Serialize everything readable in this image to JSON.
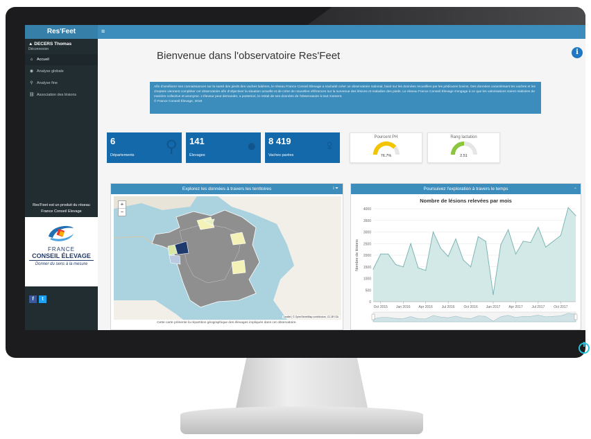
{
  "app": {
    "brand": "Res'Feet",
    "title": "Bienvenue dans l'observatoire Res'Feet",
    "info_icon": "info-icon",
    "intro": "Afin d'améliorer ses connaissances sur la santé des pieds des vaches laitières, le réseau France Conseil Élevage a souhaité créer un observatoire national, basé sur les données recueillies par les pédicures bovins. Des données caractérisant les vaches et les chepteis viennent compléter cet observatoire afin d'objectiver la situation actuelle et de créer de nouvelles références sur la survenue des lésions et maladies des pieds. Le réseau France Conseil Élevage s'engage à ce que les valorisations soient réalisées de manière collective et anonyme. L'éleveur peut demander, a posteriori, le retrait de ses données de l'observatoire à tout moment.\n© France Conseil Élevage, 2018"
  },
  "sidebar": {
    "user_name": "DECERS Thomas",
    "user_role": "Déconnexion",
    "items": [
      {
        "label": "Accueil",
        "icon": "home-icon",
        "glyph": "⌂"
      },
      {
        "label": "Analyse globale",
        "icon": "globe-icon",
        "glyph": "◉"
      },
      {
        "label": "Analyse fine",
        "icon": "search-icon",
        "glyph": "⚲"
      },
      {
        "label": "Association des lésions",
        "icon": "link-icon",
        "glyph": "⛓"
      }
    ],
    "product_text": "Res'Feet est un produit du réseau",
    "product_text2": "France Conseil Elevage",
    "logo": {
      "line1": "FRANCE",
      "line2": "CONSEIL ÉLEVAGE",
      "tagline": "Donner du sens à la mesure"
    },
    "social": {
      "facebook": "f",
      "twitter": "t"
    }
  },
  "kpis": [
    {
      "value": "6",
      "label": "Départements",
      "icon": "map-marker-icon",
      "glyph": "⚲"
    },
    {
      "value": "141",
      "label": "Élevages",
      "icon": "user-icon",
      "glyph": "●"
    },
    {
      "value": "8 419",
      "label": "Vaches parées",
      "icon": "female-icon",
      "glyph": "♀"
    }
  ],
  "gauges": [
    {
      "label": "Pourcent PH",
      "value": "76.7%",
      "fraction": 0.77,
      "color": "#f2c500"
    },
    {
      "label": "Rang lactation",
      "value": "2.51",
      "fraction": 0.5,
      "color": "#8cc63f"
    }
  ],
  "map_panel": {
    "title": "Explorez les données à travers les territoires",
    "tools": "i ⏷",
    "zoom_in": "+",
    "zoom_out": "−",
    "attribution": "Leaflet | © OpenStreetMap contributors, CC-BY-SA",
    "caption": "Cette carte présente la répartition géographique des élevages impliqués dans cet observatoire."
  },
  "chart_panel": {
    "title": "Poursuivez l'exploration à travers le temps",
    "tools": "−"
  },
  "chart_data": {
    "type": "area",
    "title": "Nombre de lésions relevées par mois",
    "xlabel": "",
    "ylabel": "Nombre de lésions",
    "ylim": [
      0,
      4000
    ],
    "yticks": [
      0,
      500,
      1000,
      1500,
      2000,
      2500,
      3000,
      3500,
      4000
    ],
    "xticks": [
      "Oct 2015",
      "Jan 2016",
      "Apr 2016",
      "Jul 2016",
      "Oct 2016",
      "Jan 2017",
      "Apr 2017",
      "Jul 2017",
      "Oct 2017"
    ],
    "x": [
      "Sep 2015",
      "Oct 2015",
      "Nov 2015",
      "Dec 2015",
      "Jan 2016",
      "Feb 2016",
      "Mar 2016",
      "Apr 2016",
      "May 2016",
      "Jun 2016",
      "Jul 2016",
      "Aug 2016",
      "Sep 2016",
      "Oct 2016",
      "Nov 2016",
      "Dec 2016",
      "Jan 2017",
      "Feb 2017",
      "Mar 2017",
      "Apr 2017",
      "May 2017",
      "Jun 2017",
      "Jul 2017",
      "Aug 2017",
      "Sep 2017",
      "Oct 2017",
      "Nov 2017",
      "Dec 2017"
    ],
    "values": [
      1400,
      2050,
      2050,
      1600,
      1500,
      2500,
      1450,
      1350,
      3000,
      2300,
      1950,
      2700,
      1800,
      1500,
      2800,
      2600,
      300,
      2450,
      3100,
      2050,
      2600,
      2550,
      3200,
      2350,
      2600,
      2850,
      4050,
      3700
    ],
    "grid": true,
    "legend": "none",
    "colors": {
      "line": "#7fb5b5",
      "fill": "#d3e9e7"
    }
  }
}
